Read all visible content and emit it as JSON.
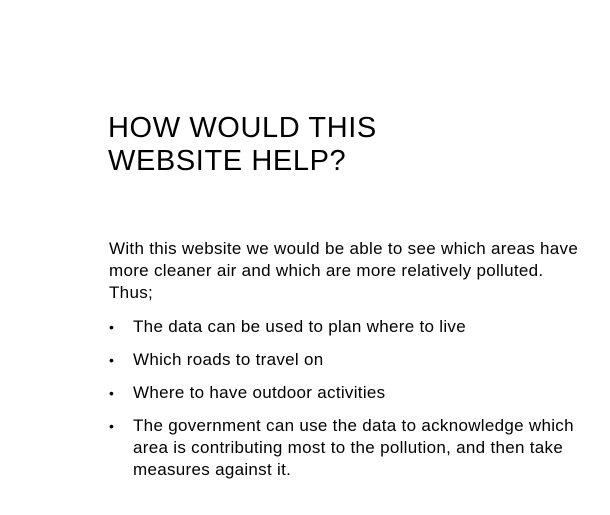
{
  "slide": {
    "title_lines": [
      "HOW WOULD THIS",
      "WEBSITE HELP?"
    ],
    "intro": "With this website we would be able to see which areas have more cleaner air and which are more relatively polluted. Thus;",
    "bullet_symbol": "•",
    "bullets": [
      "The data can be used to plan where to live",
      "Which roads to travel on",
      "Where to have outdoor activities",
      "The government can use the data to acknowledge which area is contributing most to the pollution, and then take measures against it."
    ]
  }
}
